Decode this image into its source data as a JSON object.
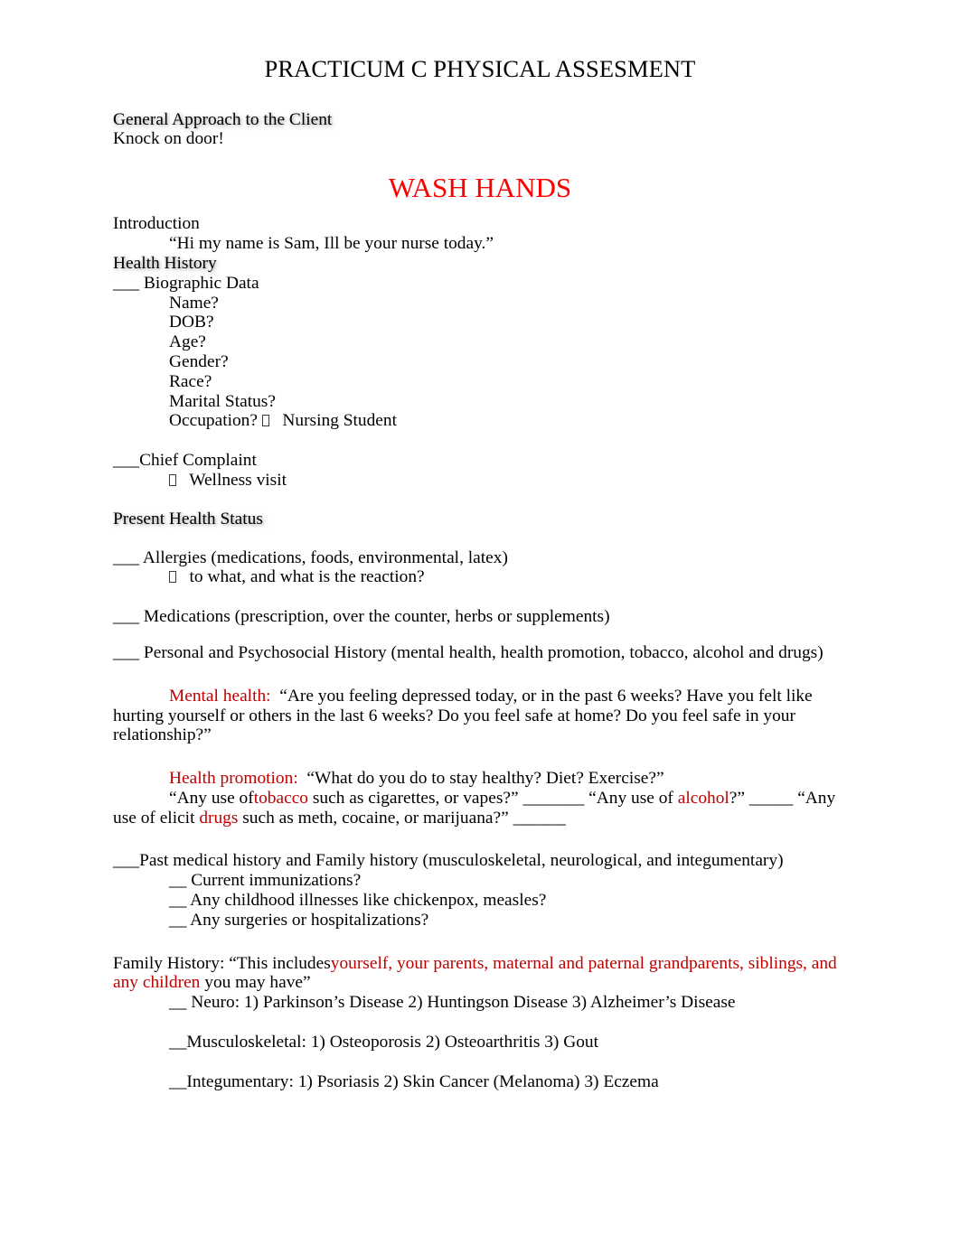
{
  "document": {
    "title": "PRACTICUM C PHYSICAL ASSESMENT",
    "colors": {
      "banner_red": "#ff0000",
      "accent_red": "#c00000",
      "body_black": "#000000",
      "page_background": "#ffffff"
    }
  },
  "general_approach": {
    "heading": "General Approach to the Client",
    "line": "Knock on door!"
  },
  "banner": {
    "wash_hands": "WASH HANDS"
  },
  "introduction": {
    "heading": "Introduction",
    "script_line": "“Hi my name is Sam, Ill be your nurse today.”"
  },
  "health_history": {
    "heading": "Health History",
    "biographic_data": {
      "label": "___ Biographic Data",
      "items": [
        "Name?",
        "DOB?",
        "Age?",
        "Gender?",
        "Race?",
        "Marital Status?"
      ],
      "occupation_label": "Occupation?",
      "occupation_value": "Nursing Student"
    },
    "chief_complaint": {
      "label": "___Chief Complaint",
      "bullet_item": "Wellness visit"
    }
  },
  "present_health_status": {
    "heading": "Present Health Status",
    "allergies": {
      "label": "___ Allergies (medications, foods, environmental, latex)",
      "bullet_item": "to what, and what is the reaction?"
    },
    "medications": {
      "label": "___ Medications (prescription, over the counter, herbs or supplements)"
    },
    "personal_psychosocial": {
      "label": "___ Personal and Psychosocial History (mental health, health promotion, tobacco, alcohol and drugs)"
    },
    "mental_health": {
      "label": "Mental health:",
      "text": "“Are you feeling depressed today, or in the past 6 weeks? Have you felt like hurting yourself or others in the last 6 weeks? Do you feel safe at home? Do you feel safe in your relationship?”"
    },
    "health_promotion": {
      "label": "Health promotion:",
      "text": "“What do you do to stay healthy? Diet? Exercise?”",
      "substance_line": {
        "seg1": "“Any use of",
        "tobacco": "tobacco",
        "seg2": " such as cigarettes, or vapes?” ",
        "blank1": "_______",
        "seg3": " “Any use of ",
        "alcohol": "alcohol",
        "seg4": "?” ",
        "blank2": "_____",
        "seg5": " “Any use of elicit ",
        "drugs": "drugs",
        "seg6": " such as meth, cocaine, or marijuana?” ",
        "blank3": "______"
      }
    }
  },
  "past_medical_history": {
    "label": "___Past medical history and Family history (musculoskeletal, neurological, and integumentary)",
    "items": [
      "__ Current immunizations?",
      "__ Any childhood illnesses like chickenpox, measles?",
      "__ Any surgeries or hospitalizations?"
    ]
  },
  "family_history": {
    "lead_black": "Family History: “This includes",
    "lead_red": "yourself, your parents, maternal and paternal grandparents, siblings, and any children",
    "tail_black": "you may have”",
    "systems": [
      "__ Neuro: 1) Parkinson’s Disease 2) Huntingson Disease 3) Alzheimer’s Disease",
      "__Musculoskeletal: 1) Osteoporosis 2) Osteoarthritis 3) Gout",
      "__Integumentary: 1) Psoriasis 2) Skin Cancer (Melanoma) 3) Eczema"
    ]
  }
}
